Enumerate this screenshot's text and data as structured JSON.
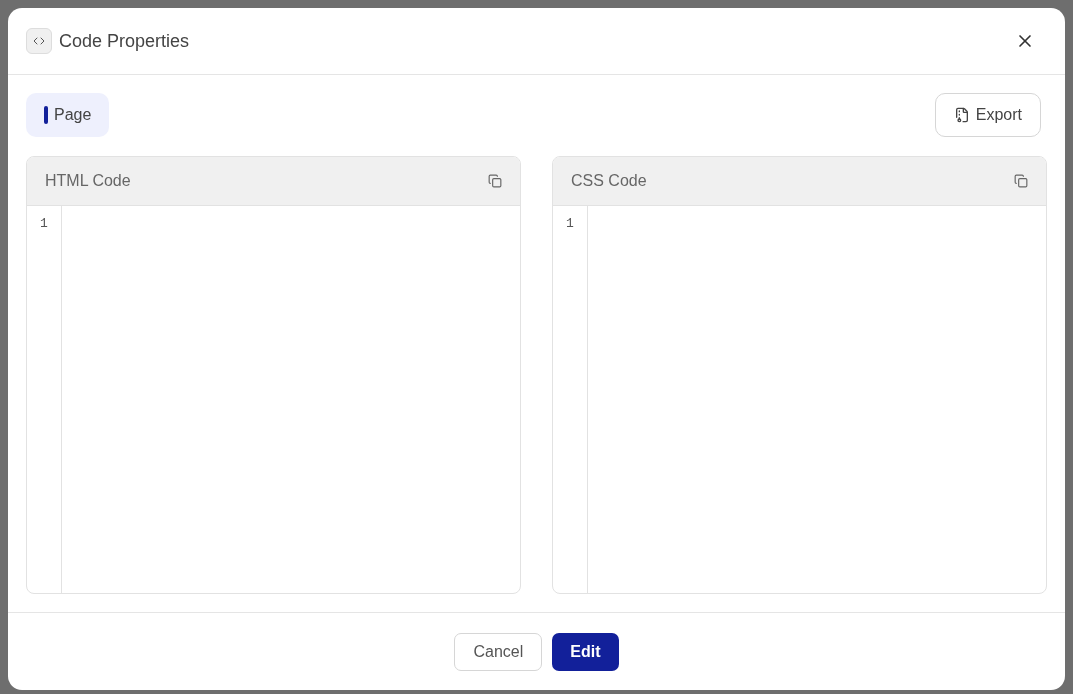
{
  "dialog": {
    "title": "Code Properties",
    "tabs": [
      {
        "label": "Page",
        "selected": true
      }
    ],
    "export_button": "Export",
    "panels": [
      {
        "title": "HTML Code",
        "line_numbers": [
          "1"
        ]
      },
      {
        "title": "CSS Code",
        "line_numbers": [
          "1"
        ]
      }
    ],
    "buttons": [
      {
        "label": "Cancel",
        "kind": "secondary"
      },
      {
        "label": "Edit",
        "kind": "primary"
      }
    ]
  }
}
